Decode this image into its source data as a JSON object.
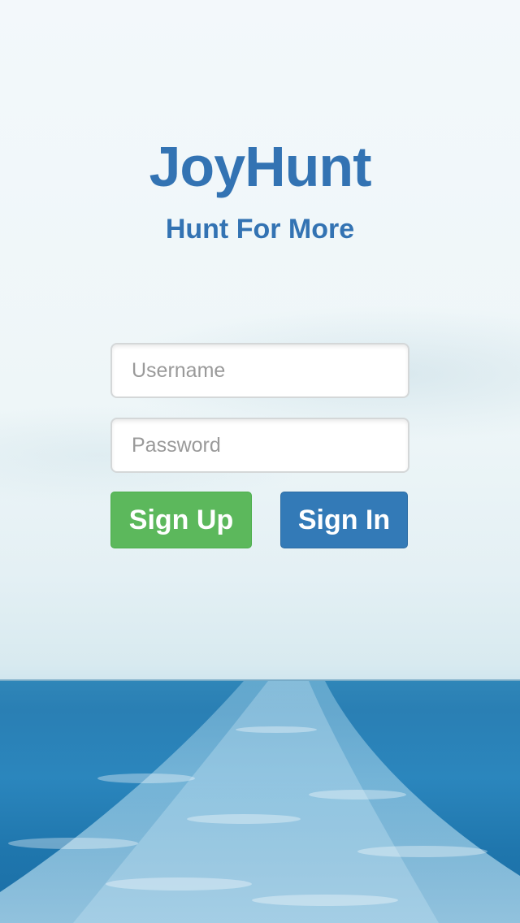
{
  "app": {
    "title": "JoyHunt",
    "tagline": "Hunt For More"
  },
  "form": {
    "username_placeholder": "Username",
    "password_placeholder": "Password",
    "signup_label": "Sign Up",
    "signin_label": "Sign In"
  },
  "colors": {
    "brand_blue": "#3373b3",
    "signup_green": "#5cb85c",
    "signin_blue": "#337ab7"
  }
}
